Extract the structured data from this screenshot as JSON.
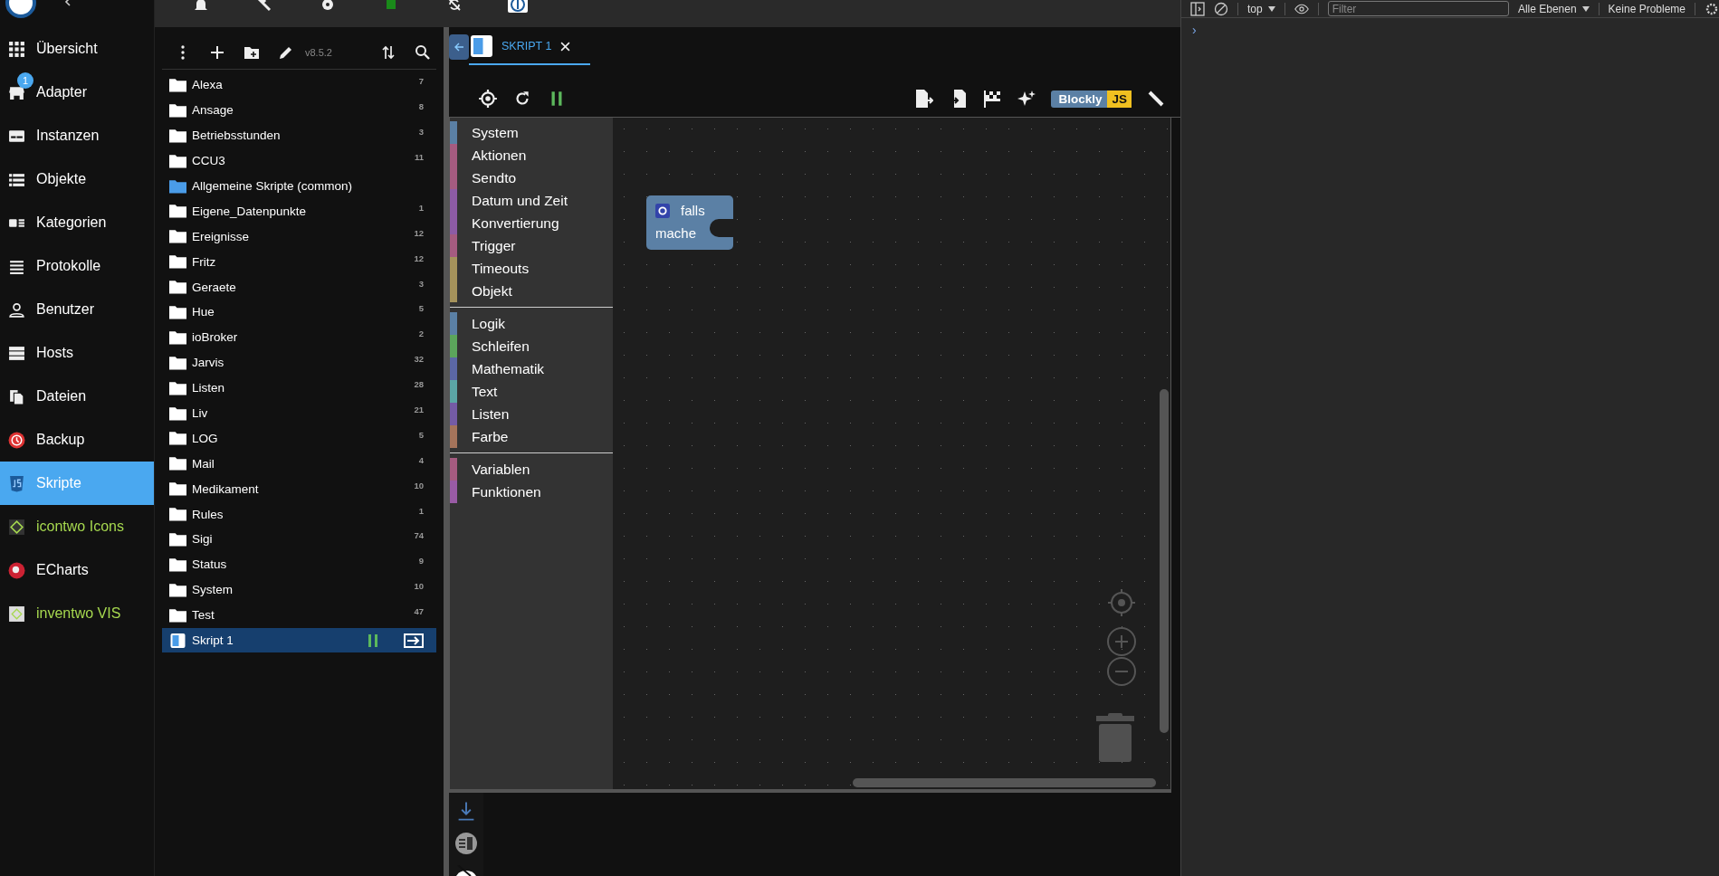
{
  "nav": [
    {
      "label": "Übersicht",
      "selected": false,
      "kind": "core"
    },
    {
      "label": "Adapter",
      "selected": false,
      "kind": "core",
      "badge": "1"
    },
    {
      "label": "Instanzen",
      "selected": false,
      "kind": "core"
    },
    {
      "label": "Objekte",
      "selected": false,
      "kind": "core"
    },
    {
      "label": "Kategorien",
      "selected": false,
      "kind": "core"
    },
    {
      "label": "Protokolle",
      "selected": false,
      "kind": "core"
    },
    {
      "label": "Benutzer",
      "selected": false,
      "kind": "core"
    },
    {
      "label": "Hosts",
      "selected": false,
      "kind": "core"
    },
    {
      "label": "Dateien",
      "selected": false,
      "kind": "core"
    },
    {
      "label": "Backup",
      "selected": false,
      "kind": "core"
    },
    {
      "label": "Skripte",
      "selected": true,
      "kind": "core"
    },
    {
      "label": "icontwo Icons",
      "selected": false,
      "kind": "adapter"
    },
    {
      "label": "ECharts",
      "selected": false,
      "kind": "core"
    },
    {
      "label": "inventwo VIS",
      "selected": false,
      "kind": "adapter"
    }
  ],
  "scripts": {
    "version": "v8.5.2",
    "items": [
      {
        "name": "Alexa",
        "count": "7",
        "kind": "folder",
        "selected": false
      },
      {
        "name": "Ansage",
        "count": "8",
        "kind": "folder",
        "selected": false
      },
      {
        "name": "Betriebsstunden",
        "count": "3",
        "kind": "folder",
        "selected": false
      },
      {
        "name": "CCU3",
        "count": "11",
        "kind": "folder",
        "selected": false
      },
      {
        "name": "Allgemeine Skripte (common)",
        "kind": "common",
        "selected": false
      },
      {
        "name": "Eigene_Datenpunkte",
        "count": "1",
        "kind": "folder",
        "selected": false
      },
      {
        "name": "Ereignisse",
        "count": "12",
        "kind": "folder",
        "selected": false
      },
      {
        "name": "Fritz",
        "count": "12",
        "kind": "folder",
        "selected": false
      },
      {
        "name": "Geraete",
        "count": "3",
        "kind": "folder",
        "selected": false
      },
      {
        "name": "Hue",
        "count": "5",
        "kind": "folder",
        "selected": false
      },
      {
        "name": "ioBroker",
        "count": "2",
        "kind": "folder",
        "selected": false
      },
      {
        "name": "Jarvis",
        "count": "32",
        "kind": "folder",
        "selected": false
      },
      {
        "name": "Listen",
        "count": "28",
        "kind": "folder",
        "selected": false
      },
      {
        "name": "Liv",
        "count": "21",
        "kind": "folder",
        "selected": false
      },
      {
        "name": "LOG",
        "count": "5",
        "kind": "folder",
        "selected": false
      },
      {
        "name": "Mail",
        "count": "4",
        "kind": "folder",
        "selected": false
      },
      {
        "name": "Medikament",
        "count": "10",
        "kind": "folder",
        "selected": false
      },
      {
        "name": "Rules",
        "count": "1",
        "kind": "folder",
        "selected": false
      },
      {
        "name": "Sigi",
        "count": "74",
        "kind": "folder",
        "selected": false
      },
      {
        "name": "Status",
        "count": "9",
        "kind": "folder",
        "selected": false
      },
      {
        "name": "System",
        "count": "10",
        "kind": "folder",
        "selected": false
      },
      {
        "name": "Test",
        "count": "47",
        "kind": "folder",
        "selected": false
      },
      {
        "name": "Skript 1",
        "kind": "script",
        "selected": true,
        "running": true
      }
    ]
  },
  "editor": {
    "tabs": [
      {
        "label": "SKRIPT 1",
        "selected": true
      }
    ],
    "running": true,
    "mode_badge": {
      "left": "Blockly",
      "right": "JS"
    },
    "toolbox": [
      [
        {
          "label": "System",
          "color": "#5b80a5"
        },
        {
          "label": "Aktionen",
          "color": "#a55b80"
        },
        {
          "label": "Sendto",
          "color": "#a55b80"
        },
        {
          "label": "Datum und Zeit",
          "color": "#8d5ba5"
        },
        {
          "label": "Konvertierung",
          "color": "#8d5ba5"
        },
        {
          "label": "Trigger",
          "color": "#a55b80"
        },
        {
          "label": "Timeouts",
          "color": "#a5925b"
        },
        {
          "label": "Objekt",
          "color": "#a5925b"
        }
      ],
      [
        {
          "label": "Logik",
          "color": "#5b80a5"
        },
        {
          "label": "Schleifen",
          "color": "#5ba55b"
        },
        {
          "label": "Mathematik",
          "color": "#5b67a5"
        },
        {
          "label": "Text",
          "color": "#5ba5a5"
        },
        {
          "label": "Listen",
          "color": "#745ba5"
        },
        {
          "label": "Farbe",
          "color": "#a5745b"
        }
      ],
      [
        {
          "label": "Variablen",
          "color": "#a55b80"
        },
        {
          "label": "Funktionen",
          "color": "#995ba5"
        }
      ]
    ],
    "block": {
      "condition": "falls",
      "action": "mache"
    }
  },
  "devtools": {
    "context": "top",
    "filter_placeholder": "Filter",
    "levels": "Alle Ebenen",
    "issues": "Keine Probleme",
    "prompt": "›"
  }
}
